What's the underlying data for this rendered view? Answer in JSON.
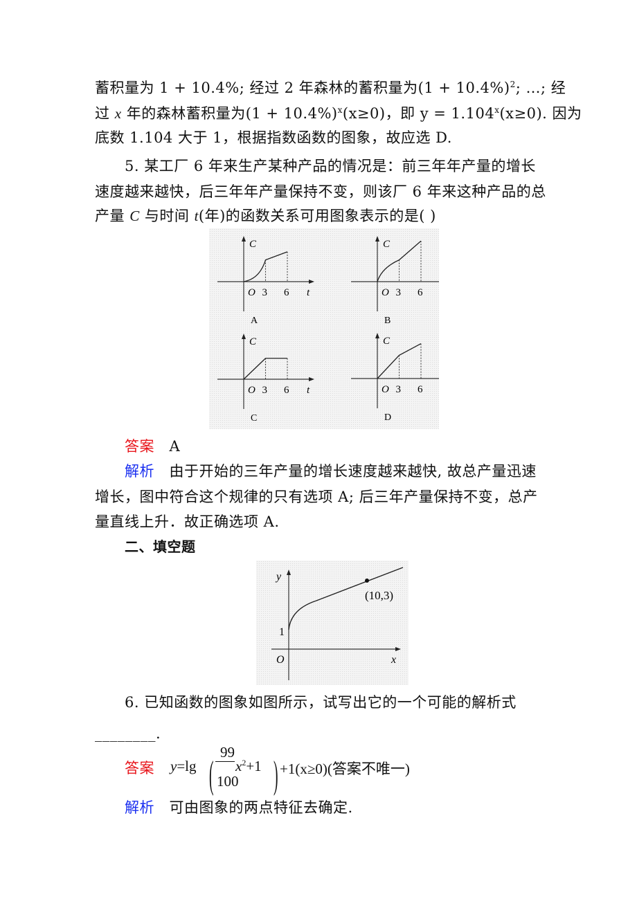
{
  "prev_solution": {
    "line1": "蓄积量为 1 + 10.4%;  经过 2 年森林的蓄积量为(1 + 10.4%)",
    "line1_sup": "2",
    "line1_tail": ";  …;  经",
    "line2_a": "过 ",
    "line2_x": "x",
    "line2_b": " 年的森林蓄积量为(1 + 10.4%)",
    "line2_sup": "x",
    "line2_c": "(x≥0)，即 y = 1.104",
    "line2_sup2": "x",
    "line2_d": "(x≥0).  因为",
    "line3": "底数 1.104 大于 1，根据指数函数的图象，故应选 D."
  },
  "q5": {
    "line1": "5.  某工厂 6 年来生产某种产品的情况是：前三年年产量的增长",
    "line2": "速度越来越快，后三年年产量保持不变，则该厂 6 年来这种产品的总",
    "line3_a": "产量 ",
    "line3_C": "C",
    "line3_b": " 与时间 ",
    "line3_t": "t",
    "line3_c": "(年)的函数关系可用图象表示的是(        )",
    "options": [
      {
        "label": "A",
        "y_axis": "C",
        "x_axis": "t",
        "origin": "O",
        "ticks": [
          "3",
          "6"
        ],
        "shape": "convex rise to t=3, then linear rise to t=6"
      },
      {
        "label": "B",
        "y_axis": "C",
        "x_axis": "t",
        "origin": "O",
        "ticks": [
          "3",
          "6"
        ],
        "shape": "concave rise to t=3, then linear rise to t=6"
      },
      {
        "label": "C",
        "y_axis": "C",
        "x_axis": "t",
        "origin": "O",
        "ticks": [
          "3",
          "6"
        ],
        "shape": "linear rise to t=3, then flat to t=6"
      },
      {
        "label": "D",
        "y_axis": "C",
        "x_axis": "t",
        "origin": "O",
        "ticks": [
          "3",
          "6"
        ],
        "shape": "linear rise to t=3, then slower linear rise to t=6"
      }
    ],
    "answer_label": "答案",
    "answer": "A",
    "analysis_label": "解析",
    "analysis_line1": "由于开始的三年产量的增长速度越来越快, 故总产量迅速",
    "analysis_line2": "增长，图中符合这个规律的只有选项 A; 后三年产量保持不变，总产",
    "analysis_line3": "量直线上升．故正确选项 A."
  },
  "section2": {
    "title": "二、填空题"
  },
  "q6_graph": {
    "y_axis": "y",
    "x_axis": "x",
    "origin": "O",
    "y_intercept_label": "1",
    "point_label": "(10,3)"
  },
  "chart_data": [
    {
      "type": "line",
      "title": "A",
      "xlabel": "t",
      "ylabel": "C",
      "x_ticks": [
        "3",
        "6"
      ],
      "points": [
        [
          0,
          0
        ],
        [
          1,
          0.3
        ],
        [
          2,
          0.8
        ],
        [
          3,
          1.6
        ],
        [
          6,
          2.2
        ]
      ]
    },
    {
      "type": "line",
      "title": "B",
      "xlabel": "t",
      "ylabel": "C",
      "x_ticks": [
        "3",
        "6"
      ],
      "points": [
        [
          0,
          0
        ],
        [
          1,
          0.9
        ],
        [
          2,
          1.3
        ],
        [
          3,
          1.6
        ],
        [
          6,
          3.0
        ]
      ]
    },
    {
      "type": "line",
      "title": "C",
      "xlabel": "t",
      "ylabel": "C",
      "x_ticks": [
        "3",
        "6"
      ],
      "points": [
        [
          0,
          0
        ],
        [
          3,
          1.8
        ],
        [
          6,
          1.8
        ]
      ]
    },
    {
      "type": "line",
      "title": "D",
      "xlabel": "t",
      "ylabel": "C",
      "x_ticks": [
        "3",
        "6"
      ],
      "points": [
        [
          0,
          0
        ],
        [
          3,
          2.0
        ],
        [
          6,
          3.0
        ]
      ]
    },
    {
      "type": "line",
      "title": "",
      "xlabel": "x",
      "ylabel": "y",
      "annotations": [
        "1",
        "(10,3)"
      ],
      "points": [
        [
          0,
          1
        ],
        [
          10,
          3
        ]
      ]
    }
  ],
  "q6": {
    "line1": "6.  已知函数的图象如图所示，试写出它的一个可能的解析式",
    "blank": "________.",
    "answer_label": "答案",
    "answer_prefix": "y=lg",
    "frac_num": "99",
    "frac_den": "100",
    "answer_inner": "x",
    "answer_inner_sup": "2",
    "answer_inner_tail": "+1",
    "answer_suffix": "+1(x≥0)(答案不唯一)",
    "analysis_label": "解析",
    "analysis": "可由图象的两点特征去确定."
  }
}
